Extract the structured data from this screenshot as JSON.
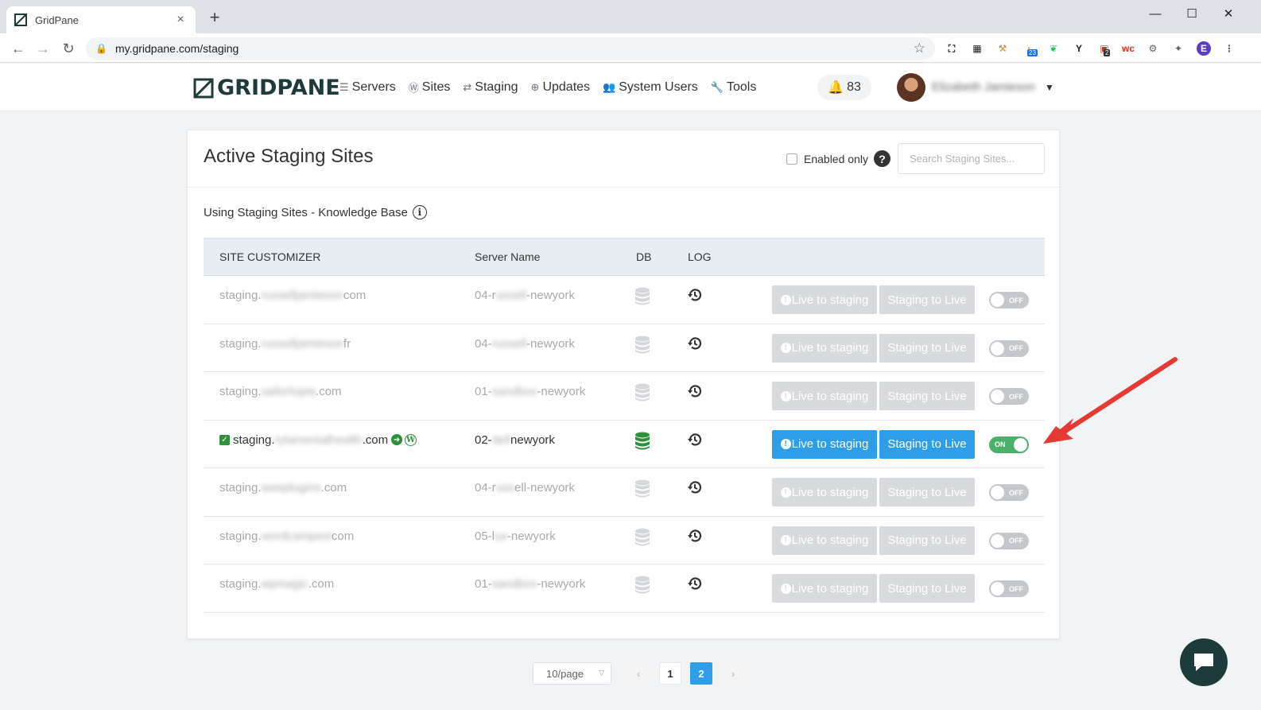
{
  "browser": {
    "tab_title": "GridPane",
    "url": "my.gridpane.com/staging",
    "tab_close": "×",
    "new_tab": "+",
    "window_controls": {
      "minimize": "—",
      "maximize": "☐",
      "close": "✕"
    },
    "extensions": [
      {
        "name": "screenshot-icon",
        "glyph": "⛶",
        "color": "#202124"
      },
      {
        "name": "apps-grid-icon",
        "glyph": "▦",
        "color": "#202124"
      },
      {
        "name": "hammer-icon",
        "glyph": "⚒",
        "color": "#c48a3a"
      },
      {
        "name": "calendar-icon",
        "glyph": "◔",
        "color": "#f5a623",
        "badge": "23"
      },
      {
        "name": "evernote-icon",
        "glyph": "❦",
        "color": "#2dbe60"
      },
      {
        "name": "yoast-icon",
        "glyph": "Y",
        "color": "#202124"
      },
      {
        "name": "todo-icon",
        "glyph": "▣",
        "color": "#d93025",
        "badge": "2"
      },
      {
        "name": "woocommerce-icon",
        "glyph": "wc",
        "color": "#d93025"
      },
      {
        "name": "settings-gear-icon",
        "glyph": "⚙",
        "color": "#5f6368"
      },
      {
        "name": "puzzle-icon",
        "glyph": "✦",
        "color": "#5f6368"
      },
      {
        "name": "profile-icon",
        "glyph": "E",
        "color": "#ffffff",
        "bg": "#5b3cc4"
      },
      {
        "name": "more-menu-icon",
        "glyph": "⋮",
        "color": "#5f6368"
      }
    ]
  },
  "header": {
    "logo_text": "GRIDPANE",
    "nav": [
      {
        "key": "servers",
        "label": "Servers",
        "icon": "☰",
        "icon_name": "servers-icon"
      },
      {
        "key": "sites",
        "label": "Sites",
        "icon": "Ⓦ",
        "icon_name": "wordpress-icon"
      },
      {
        "key": "staging",
        "label": "Staging",
        "icon": "⇄",
        "icon_name": "staging-icon"
      },
      {
        "key": "updates",
        "label": "Updates",
        "icon": "⊕",
        "icon_name": "updates-icon"
      },
      {
        "key": "system_users",
        "label": "System Users",
        "icon": "👥",
        "icon_name": "users-icon"
      },
      {
        "key": "tools",
        "label": "Tools",
        "icon": "🔧",
        "icon_name": "wrench-icon"
      }
    ],
    "notifications_count": "83",
    "user_name": "Elizabeth Jamieson"
  },
  "card": {
    "title": "Active Staging Sites",
    "enabled_only_label": "Enabled only",
    "search_placeholder": "Search Staging Sites...",
    "kb_link": "Using Staging Sites - Knowledge Base",
    "columns": {
      "site": "SITE CUSTOMIZER",
      "server": "Server Name",
      "db": "DB",
      "log": "LOG"
    },
    "btn_live_to_staging": "Live to staging",
    "btn_staging_to_live": "Staging to Live",
    "toggle_on": "ON",
    "toggle_off": "OFF",
    "rows": [
      {
        "site_prefix": "staging.",
        "site_blur": "russelljamieson",
        "site_suffix": "com",
        "server_prefix": "04-r",
        "server_blur": "ussell",
        "server_suffix": "-newyork",
        "enabled": false
      },
      {
        "site_prefix": "staging.",
        "site_blur": "russelljamieson",
        "site_suffix": "fr",
        "server_prefix": "04-",
        "server_blur": "russell",
        "server_suffix": "-newyork",
        "enabled": false
      },
      {
        "site_prefix": "staging.",
        "site_blur": "sailortopia",
        "site_suffix": ".com",
        "server_prefix": "01-",
        "server_blur": "sandbox",
        "server_suffix": "-newyork",
        "enabled": false
      },
      {
        "site_prefix": "staging.",
        "site_blur": "rylamentalhealth",
        "site_suffix": ".com",
        "server_prefix": "02-",
        "server_blur": "dell",
        "server_suffix": " newyork",
        "enabled": true
      },
      {
        "site_prefix": "staging.",
        "site_blur": "weeplugins",
        "site_suffix": ".com",
        "server_prefix": "04-r",
        "server_blur": "uss",
        "server_suffix": "ell-newyork",
        "enabled": false
      },
      {
        "site_prefix": "staging.",
        "site_blur": "wordcampesl",
        "site_suffix": "com",
        "server_prefix": "05-l",
        "server_blur": "ux",
        "server_suffix": "-newyork",
        "enabled": false
      },
      {
        "site_prefix": "staging.",
        "site_blur": "wpmagic",
        "site_suffix": ".com",
        "server_prefix": "01-",
        "server_blur": "sandbox",
        "server_suffix": "-newyork",
        "enabled": false
      }
    ]
  },
  "pagination": {
    "page_size": "10/page",
    "pages": [
      "1",
      "2"
    ],
    "current": "2",
    "prev": "‹",
    "next": "›"
  },
  "colors": {
    "primary": "#2e9ee9",
    "disabled": "#d8dadd",
    "toggle_on": "#4caf6b",
    "db_active": "#2f8f3f",
    "annotation_arrow": "#e53935"
  }
}
